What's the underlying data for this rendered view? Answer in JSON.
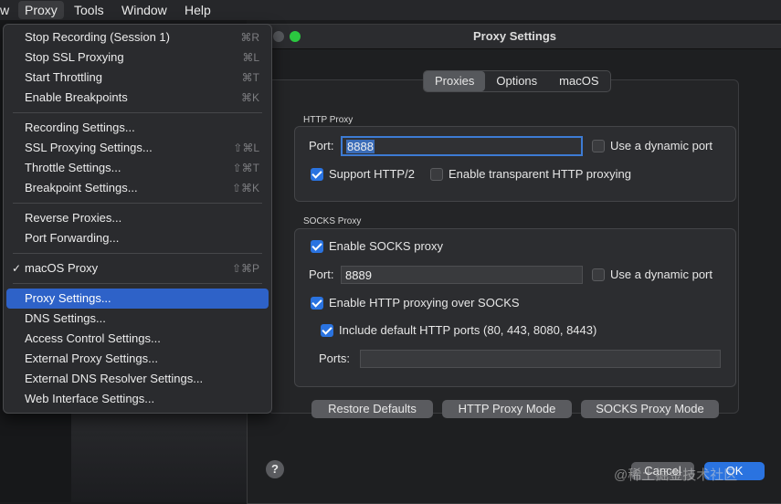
{
  "menubar": {
    "partial_left": "w",
    "items": [
      "Proxy",
      "Tools",
      "Window",
      "Help"
    ]
  },
  "dialog": {
    "title": "Proxy Settings",
    "tabs": [
      "Proxies",
      "Options",
      "macOS"
    ],
    "http_proxy": {
      "section_label": "HTTP Proxy",
      "port_label": "Port:",
      "port_value": "8888",
      "dynamic_port_label": "Use a dynamic port",
      "support_http2_label": "Support HTTP/2",
      "transparent_label": "Enable transparent HTTP proxying"
    },
    "socks_proxy": {
      "section_label": "SOCKS Proxy",
      "enable_label": "Enable SOCKS proxy",
      "port_label": "Port:",
      "port_value": "8889",
      "dynamic_port_label": "Use a dynamic port",
      "http_over_socks_label": "Enable HTTP proxying over SOCKS",
      "include_default_label": "Include default HTTP ports (80, 443, 8080, 8443)",
      "ports_label": "Ports:",
      "ports_value": ""
    },
    "buttons": {
      "restore": "Restore Defaults",
      "http_mode": "HTTP Proxy Mode",
      "socks_mode": "SOCKS Proxy Mode",
      "cancel": "Cancel",
      "ok": "OK",
      "help": "?"
    }
  },
  "proxy_menu": {
    "group1": [
      {
        "label": "Stop Recording (Session 1)",
        "shortcut": "⌘R"
      },
      {
        "label": "Stop SSL Proxying",
        "shortcut": "⌘L"
      },
      {
        "label": "Start Throttling",
        "shortcut": "⌘T"
      },
      {
        "label": "Enable Breakpoints",
        "shortcut": "⌘K"
      }
    ],
    "group2": [
      {
        "label": "Recording Settings...",
        "shortcut": ""
      },
      {
        "label": "SSL Proxying Settings...",
        "shortcut": "⇧⌘L"
      },
      {
        "label": "Throttle Settings...",
        "shortcut": "⇧⌘T"
      },
      {
        "label": "Breakpoint Settings...",
        "shortcut": "⇧⌘K"
      }
    ],
    "group3": [
      {
        "label": "Reverse Proxies...",
        "shortcut": ""
      },
      {
        "label": "Port Forwarding...",
        "shortcut": ""
      }
    ],
    "group4": [
      {
        "label": "macOS Proxy",
        "shortcut": "⇧⌘P",
        "check": "✓"
      }
    ],
    "group5": [
      {
        "label": "Proxy Settings...",
        "shortcut": ""
      },
      {
        "label": "DNS Settings...",
        "shortcut": ""
      },
      {
        "label": "Access Control Settings...",
        "shortcut": ""
      },
      {
        "label": "External Proxy Settings...",
        "shortcut": ""
      },
      {
        "label": "External DNS Resolver Settings...",
        "shortcut": ""
      },
      {
        "label": "Web Interface Settings...",
        "shortcut": ""
      }
    ]
  },
  "watermark": "@稀土掘金技术社区",
  "colors": {
    "accent": "#2a73e0",
    "menu_selected": "#2e62c8",
    "window_bg": "#1e1f21"
  }
}
